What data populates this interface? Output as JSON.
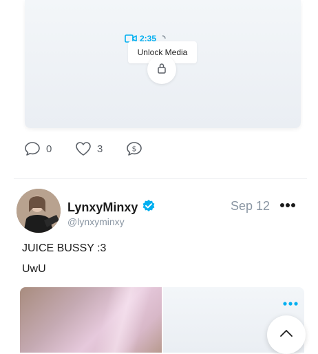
{
  "colors": {
    "accent": "#00aff0",
    "muted_text": "#8a96a3",
    "icon_gray": "#5a5f66",
    "verified": "#00aff0"
  },
  "locked_media": {
    "duration": "2:35",
    "unlock_label": "Unlock Media",
    "icons": {
      "video": "video-camera-icon",
      "lock": "lock-icon"
    }
  },
  "actions": {
    "comments_count": "0",
    "likes_count": "3",
    "icons": {
      "comment": "comment-icon",
      "like": "heart-icon",
      "tip": "dollar-tip-icon"
    }
  },
  "post": {
    "display_name": "LynxyMinxy",
    "handle": "@lynxyminxy",
    "date": "Sep 12",
    "text_lines": [
      "JUICE BUSSY :3",
      "UwU"
    ],
    "icons": {
      "verified": "verified-badge-icon",
      "more": "more-dots-icon"
    }
  },
  "scroll_top": {
    "icon": "chevron-up-icon"
  }
}
